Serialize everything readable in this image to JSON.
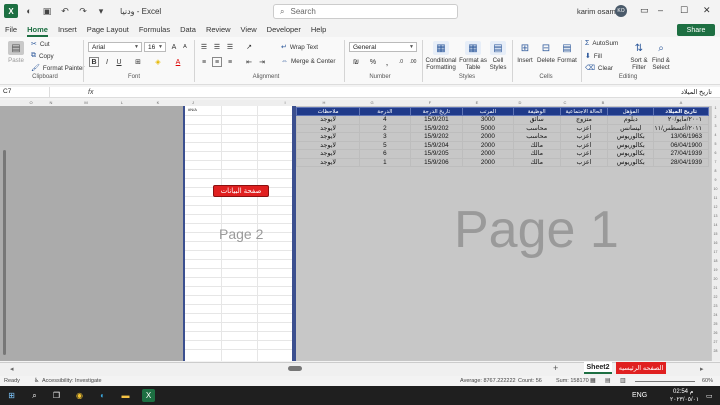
{
  "window": {
    "title": "ودنيا  -  Excel",
    "search_placeholder": "Search",
    "user_name": "karim osama",
    "user_initials": "KO"
  },
  "menu": [
    "File",
    "Home",
    "Insert",
    "Page Layout",
    "Formulas",
    "Data",
    "Review",
    "View",
    "Developer",
    "Help"
  ],
  "share_label": "Share",
  "ribbon": {
    "clipboard": {
      "paste": "Paste",
      "cut": "Cut",
      "copy": "Copy",
      "format_painter": "Format Painter",
      "label": "Clipboard"
    },
    "font": {
      "name": "Arial",
      "size": "16",
      "label": "Font"
    },
    "alignment": {
      "wrap": "Wrap Text",
      "merge": "Merge & Center",
      "label": "Alignment"
    },
    "number": {
      "format": "General",
      "label": "Number"
    },
    "styles": {
      "cond": "Conditional Formatting",
      "table": "Format as Table",
      "cell": "Cell Styles",
      "label": "Styles"
    },
    "cells": {
      "insert": "Insert",
      "delete": "Delete",
      "format": "Format",
      "label": "Cells"
    },
    "editing": {
      "autosum": "AutoSum",
      "fill": "Fill",
      "clear": "Clear",
      "sort": "Sort & Filter",
      "find": "Find & Select",
      "label": "Editing"
    }
  },
  "formula_bar": {
    "name_box": "C7",
    "fx": "fx",
    "content": "تاريخ الميلاد"
  },
  "columns_right": [
    "A",
    "B",
    "C",
    "D",
    "E",
    "F",
    "G",
    "H",
    "I"
  ],
  "columns_left": [
    "O",
    "N",
    "M",
    "L",
    "K",
    "J"
  ],
  "page_labels": {
    "page1": "Page 1",
    "page2": "Page 2",
    "cell_note": "#N/A"
  },
  "data_button": "صفحة البيانات",
  "table": {
    "headers": [
      "تاريخ الميلاد",
      "المؤهل",
      "الحالة الاجتماعية",
      "الوظيفة",
      "المرتب",
      "تاريخ الدرجة",
      "الدرجة",
      "ملاحظات"
    ],
    "rows": [
      [
        "٢٠٠١/مايو/٢٠",
        "دبلوم",
        "متزوج",
        "سائق",
        "3000",
        "15/9/201",
        "4",
        "لايوجد"
      ],
      [
        "٢٠١١/أغسطس/١١",
        "ليسانس",
        "اعزب",
        "محاسب",
        "5000",
        "15/9/202",
        "2",
        "لايوجد"
      ],
      [
        "13/06/1963",
        "بكالوريوس",
        "اعزب",
        "محاسب",
        "2000",
        "15/9/202",
        "3",
        "لايوجد"
      ],
      [
        "06/04/1900",
        "بكالوريوس",
        "اعزب",
        "مالك",
        "2000",
        "15/9/204",
        "5",
        "لايوجد"
      ],
      [
        "27/04/1939",
        "بكالوريوس",
        "اعزب",
        "مالك",
        "2000",
        "15/9/205",
        "6",
        "لايوجد"
      ],
      [
        "28/04/1939",
        "بكالوريوس",
        "اعزب",
        "مالك",
        "2000",
        "15/9/206",
        "1",
        "لايوجد"
      ]
    ]
  },
  "sheets": {
    "sheet2": "Sheet2",
    "main": "الصفحه الرئيسيه"
  },
  "status": {
    "ready": "Ready",
    "accessibility": "Accessibility: Investigate",
    "average": "Average: 8767.222222",
    "count": "Count: 56",
    "sum": "Sum: 158170",
    "zoom": "60%"
  },
  "taskbar": {
    "lang": "ENG",
    "time": "02:54 م",
    "date": "٢٠٢٣/٠٥/٠١"
  },
  "colors": {
    "excel_green": "#1d6f42",
    "header_blue": "#1f3a8a",
    "red_button": "#e02020"
  }
}
